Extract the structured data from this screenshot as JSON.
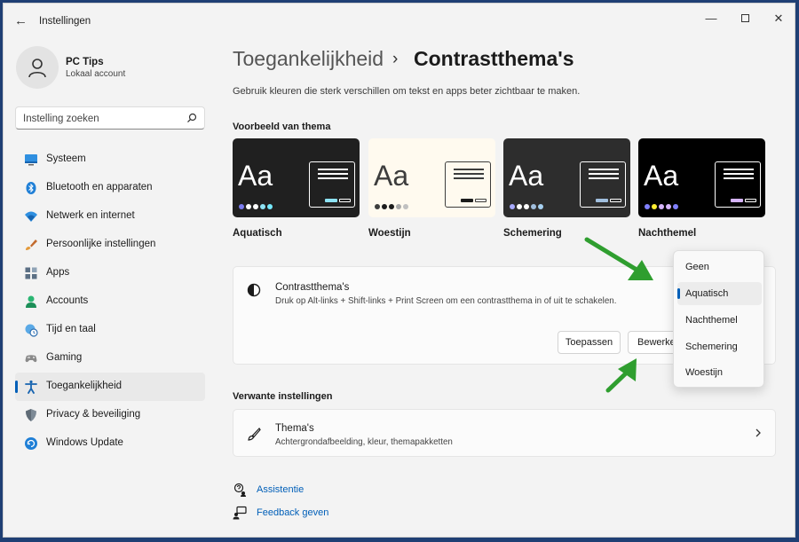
{
  "titlebar": {
    "app_title": "Instellingen",
    "back_glyph": "←",
    "minimize_glyph": "—",
    "close_glyph": "✕"
  },
  "user": {
    "name": "PC Tips",
    "account_type": "Lokaal account"
  },
  "search": {
    "placeholder": "Instelling zoeken"
  },
  "sidebar": {
    "items": [
      {
        "label": "Systeem",
        "icon": "monitor-icon"
      },
      {
        "label": "Bluetooth en apparaten",
        "icon": "bluetooth-icon"
      },
      {
        "label": "Netwerk en internet",
        "icon": "wifi-icon"
      },
      {
        "label": "Persoonlijke instellingen",
        "icon": "brush-icon"
      },
      {
        "label": "Apps",
        "icon": "apps-icon"
      },
      {
        "label": "Accounts",
        "icon": "person-icon"
      },
      {
        "label": "Tijd en taal",
        "icon": "globe-clock-icon"
      },
      {
        "label": "Gaming",
        "icon": "gamepad-icon"
      },
      {
        "label": "Toegankelijkheid",
        "icon": "accessibility-icon",
        "active": true
      },
      {
        "label": "Privacy & beveiliging",
        "icon": "shield-icon"
      },
      {
        "label": "Windows Update",
        "icon": "update-icon"
      }
    ]
  },
  "header": {
    "parent": "Toegankelijkheid",
    "separator": "›",
    "current": "Contrastthema's",
    "description": "Gebruik kleuren die sterk verschillen om tekst en apps beter zichtbaar te maken."
  },
  "preview": {
    "title": "Voorbeeld van thema",
    "aa_text": "Aa",
    "themes": [
      {
        "name": "Aquatisch",
        "bg": "#202020",
        "fg": "#ffffff",
        "dots": [
          "#7c7cf0",
          "#ffffff",
          "#ffffff",
          "#8ee3f5",
          "#75e9fc"
        ],
        "accent": "#8ee3f5"
      },
      {
        "name": "Woestijn",
        "bg": "#fffaef",
        "fg": "#3d3d3d",
        "dots": [
          "#3d3d3d",
          "#1c1c1c",
          "#1c1c1c",
          "#a8a8a8",
          "#c0c0c0"
        ],
        "accent": "#1c1c1c"
      },
      {
        "name": "Schemering",
        "bg": "#2d2d2d",
        "fg": "#ffffff",
        "dots": [
          "#a8aaff",
          "#ffffff",
          "#ffffff",
          "#a1bfde",
          "#a6d0f0"
        ],
        "accent": "#a1bfde"
      },
      {
        "name": "Nachthemel",
        "bg": "#000000",
        "fg": "#ffffff",
        "dots": [
          "#8080ff",
          "#ffee32",
          "#d6b4fd",
          "#d6b4fd",
          "#8080ff"
        ],
        "accent": "#d6b4fd"
      }
    ]
  },
  "contrast_panel": {
    "title": "Contrastthema's",
    "subtitle": "Druk op Alt-links + Shift-links + Print Screen om een contrastthema in of uit te schakelen.",
    "apply_label": "Toepassen",
    "edit_label": "Bewerken"
  },
  "dropdown": {
    "options": [
      "Geen",
      "Aquatisch",
      "Nachthemel",
      "Schemering",
      "Woestijn"
    ],
    "selected": "Aquatisch"
  },
  "related": {
    "title": "Verwante instellingen",
    "item_title": "Thema's",
    "item_subtitle": "Achtergrondafbeelding, kleur, themapakketten"
  },
  "help": {
    "assist_label": "Assistentie",
    "feedback_label": "Feedback geven"
  },
  "colors": {
    "accent": "#005fb8",
    "arrow": "#2f9e2f",
    "window_bg": "#f3f3f3",
    "desktop": "#1f3f74"
  }
}
